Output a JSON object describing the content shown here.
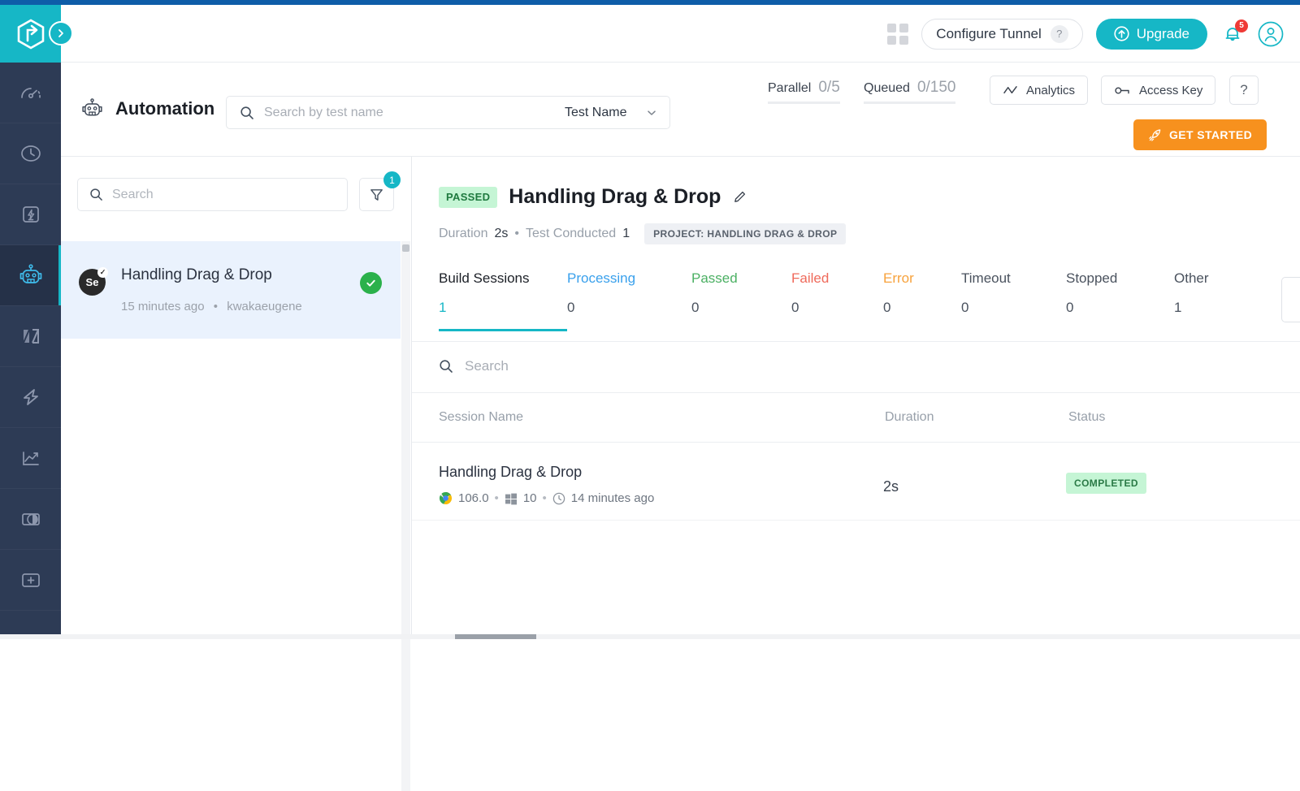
{
  "brand": {
    "accent": "#16b7c6",
    "orange": "#f7911e",
    "navy": "#2d3b55",
    "green": "#2bb14b",
    "topbar_blue": "#0e5da8"
  },
  "topbar": {
    "grid_icon": "grid-icon",
    "tunnel_label": "Configure Tunnel",
    "tunnel_help": "?",
    "upgrade_label": "Upgrade",
    "notification_count": "5",
    "bell_icon": "bell-icon",
    "avatar_icon": "user-avatar-icon"
  },
  "rail": {
    "items": [
      {
        "name": "dashboard-speedometer",
        "icon": "speedometer-icon",
        "active": false
      },
      {
        "name": "realtime-clock",
        "icon": "clock-arrow-icon",
        "active": false
      },
      {
        "name": "app-testing",
        "icon": "mobile-device-icon",
        "active": false
      },
      {
        "name": "automation",
        "icon": "robot-icon",
        "active": true
      },
      {
        "name": "visual-testing",
        "icon": "split-compare-icon",
        "active": false
      },
      {
        "name": "hyperexecute",
        "icon": "lightning-bolt-icon",
        "active": false
      },
      {
        "name": "analytics",
        "icon": "trend-chart-icon",
        "active": false
      },
      {
        "name": "smart-ui",
        "icon": "contrast-circle-icon",
        "active": false
      },
      {
        "name": "add-new",
        "icon": "plus-box-icon",
        "active": false
      }
    ]
  },
  "subheader": {
    "section_icon": "robot-icon",
    "section_title": "Automation",
    "search_placeholder": "Search by test name",
    "search_value": "",
    "search_icon": "search-icon",
    "filter_select_label": "Test Name",
    "chevron_icon": "chevron-down-icon",
    "stats": [
      {
        "label": "Parallel",
        "value": "0/5"
      },
      {
        "label": "Queued",
        "value": "0/150"
      }
    ],
    "analytics_label": "Analytics",
    "analytics_icon": "trend-line-icon",
    "access_key_label": "Access Key",
    "access_key_icon": "key-icon",
    "help_label": "?",
    "get_started_label": "GET STARTED",
    "get_started_icon": "rocket-icon"
  },
  "list_panel": {
    "search_placeholder": "Search",
    "search_value": "",
    "search_icon": "search-icon",
    "filter_icon": "funnel-icon",
    "filter_badge": "1",
    "items": [
      {
        "framework_badge": "Se",
        "name": "Handling Drag & Drop",
        "time": "15 minutes ago",
        "separator": "•",
        "user": "kwakaeugene",
        "status_icon": "check-circle-icon"
      }
    ]
  },
  "detail": {
    "status_badge": "PASSED",
    "title": "Handling Drag & Drop",
    "edit_icon": "pencil-icon",
    "duration_label": "Duration",
    "duration_value": "2s",
    "meta_separator": "•",
    "tests_conducted_label": "Test Conducted",
    "tests_conducted_value": "1",
    "project_chip": "PROJECT: HANDLING DRAG & DROP",
    "tabs": [
      {
        "label": "Build Sessions",
        "value": "1",
        "color": "#1b1f26",
        "active": true
      },
      {
        "label": "Processing",
        "value": "0",
        "color": "#39a0ec",
        "active": false
      },
      {
        "label": "Passed",
        "value": "0",
        "color": "#4bb063",
        "active": false
      },
      {
        "label": "Failed",
        "value": "0",
        "color": "#ef6a5b",
        "active": false
      },
      {
        "label": "Error",
        "value": "0",
        "color": "#f7a23c",
        "active": false
      },
      {
        "label": "Timeout",
        "value": "0",
        "color": "#4a525e",
        "active": false
      },
      {
        "label": "Stopped",
        "value": "0",
        "color": "#4a525e",
        "active": false
      },
      {
        "label": "Other",
        "value": "1",
        "color": "#4a525e",
        "active": false
      }
    ],
    "session_search_placeholder": "Search",
    "session_search_value": "",
    "session_search_icon": "search-icon",
    "table": {
      "columns": [
        "Session Name",
        "Duration",
        "Status"
      ],
      "rows": [
        {
          "name": "Handling Drag & Drop",
          "browser_icon": "chrome-icon",
          "browser_version": "106.0",
          "os_icon": "windows-icon",
          "os_version": "10",
          "time_icon": "clock-icon",
          "time": "14 minutes ago",
          "separator": "•",
          "duration": "2s",
          "status": "COMPLETED"
        }
      ]
    }
  }
}
